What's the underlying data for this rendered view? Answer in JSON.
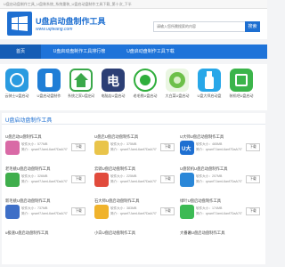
{
  "topbar": {
    "text": "U盘启动盘制作工具_U盘装系统_系统重装_U盘启动盘制作工具下载_第十次_下半"
  },
  "header": {
    "site_name": "U盘启动盘制作工具",
    "site_url": "www.uqiwang.com",
    "search_placeholder": "请输入您所需搜索的内容",
    "search_button": "搜索"
  },
  "nav": {
    "items": [
      "首页",
      "U盘启动盘制作工具排行榜",
      "U盘启动盘制作工具下载"
    ]
  },
  "apps": [
    {
      "label": "云骑士U盘启动",
      "icon": "blue-circle-icon",
      "color": "#2a9be0"
    },
    {
      "label": "U盘启动盘制作",
      "icon": "blue-usb-icon",
      "color": "#1f7ed6"
    },
    {
      "label": "系统之家U盘启动",
      "icon": "home-icon",
      "color": "#3aa84a"
    },
    {
      "label": "电脑店U盘启动",
      "icon": "electric-icon",
      "color": "#2c3f75"
    },
    {
      "label": "老毛桃U盘启动",
      "icon": "green-circle-icon",
      "color": "#2fae3c"
    },
    {
      "label": "大白菜U盘启动",
      "icon": "cabbage-icon",
      "color": "#6dc04a"
    },
    {
      "label": "U盘大师启动盘",
      "icon": "usb-stick-icon",
      "color": "#28a7e8"
    },
    {
      "label": "装机吧U盘启动",
      "icon": "green-square-icon",
      "color": "#3bb44a"
    }
  ],
  "section": {
    "title": "U盘启动盘制作工具"
  },
  "cards": [
    {
      "name": "U盘启动U盘制作工具",
      "size": "软件大小：577MB",
      "intro": "简介：qcwnf7JamL6anf7DaA7l7",
      "download": "下载",
      "thumb": "thumb-pink-icon",
      "color": "#d96aa6"
    },
    {
      "name": "U盘启U盘启动盘制作工具",
      "size": "软件大小：375MB",
      "intro": "简介：qcwnf7JamL6anf7DaA7l7",
      "download": "下载",
      "thumb": "thumb-cartoon-icon",
      "color": "#e9c44a"
    },
    {
      "name": "U大师U盘启动盘制作工具",
      "size": "软件大小：465MB",
      "intro": "简介：qcwnf7JamL6anf7DaA7l7",
      "download": "下载",
      "thumb": "thumb-udashi-icon",
      "color": "#1e6fd1"
    },
    {
      "name": "老毛桃U盘启动盘制作工具",
      "size": "软件大小：326MB",
      "intro": "简介：qcwnf7JamL6anf7DaA7l7",
      "download": "下载",
      "thumb": "thumb-green-icon",
      "color": "#3fae4c"
    },
    {
      "name": "云骑U盘启动盘制作工具",
      "size": "软件大小：225MB",
      "intro": "简介：qcwnf7JamL6anf7DaA7l7",
      "download": "下载",
      "thumb": "thumb-red-icon",
      "color": "#e14b3c"
    },
    {
      "name": "U盘装机U盘启动盘制作工具",
      "size": "软件大小：207MB",
      "intro": "简介：qcwnf7JamL6anf7DaA7l7",
      "download": "下载",
      "thumb": "thumb-blue-icon",
      "color": "#2a87d8"
    },
    {
      "name": "新毛桃U盘启动盘制作工具",
      "size": "软件大小：737MB",
      "intro": "简介：qcwnf7JamL6anf7DaA7l7",
      "download": "下载",
      "thumb": "thumb-blue-cartoon-icon",
      "color": "#3e6fc7"
    },
    {
      "name": "石大师U盘启动盘制作工具",
      "size": "软件大小：383MB",
      "intro": "简介：qcwnf7JamL6anf7DaA7l7",
      "download": "下载",
      "thumb": "thumb-yellow-icon",
      "color": "#f0b32c"
    },
    {
      "name": "绿叶U盘启动盘制作工具",
      "size": "软件大小：174MB",
      "intro": "简介：qcwnf7JamL6anf7DaA7l7",
      "download": "下载",
      "thumb": "thumb-greenball-icon",
      "color": "#3cba54"
    },
    {
      "name": "u极速U盘启动盘制作工具",
      "size": "",
      "intro": "",
      "download": "",
      "thumb": "",
      "color": ""
    },
    {
      "name": "小白U盘启动盘制作工具",
      "size": "",
      "intro": "",
      "download": "",
      "thumb": "",
      "color": ""
    },
    {
      "name": "大番薯U盘启动盘制作工具",
      "size": "",
      "intro": "",
      "download": "",
      "thumb": "",
      "color": ""
    }
  ]
}
